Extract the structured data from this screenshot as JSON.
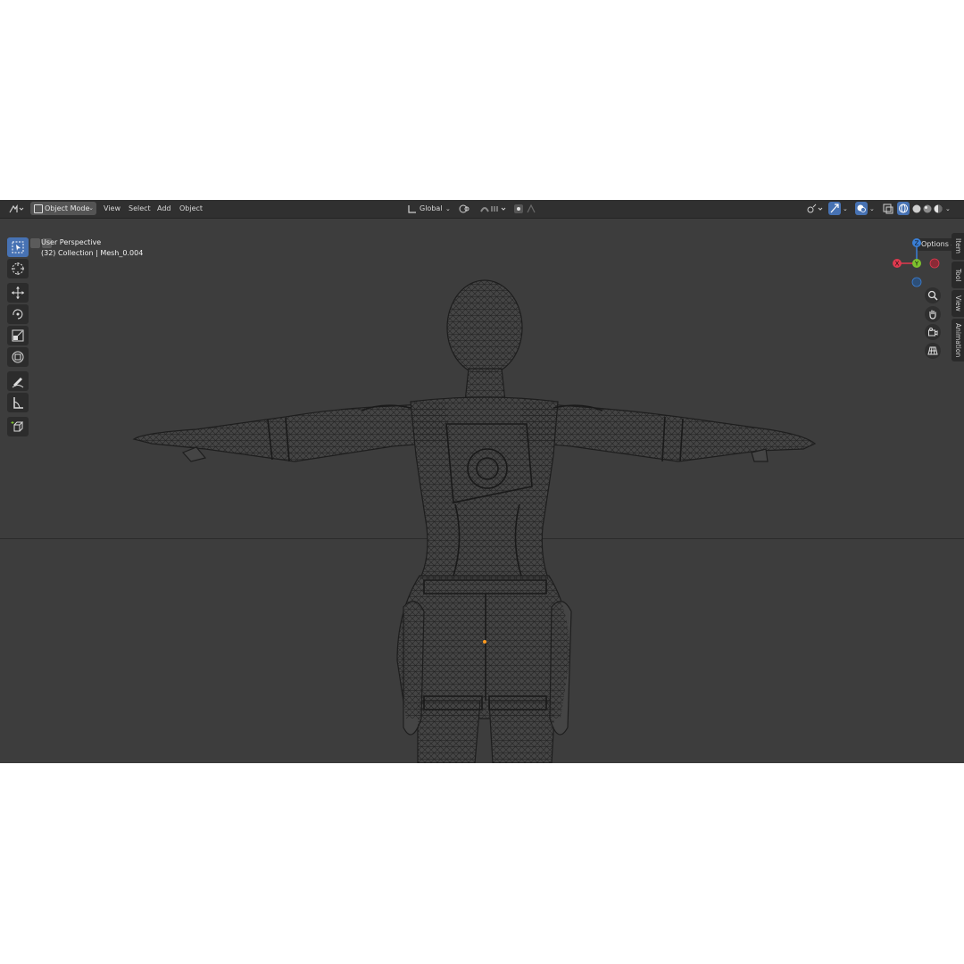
{
  "header": {
    "mode_label": "Object Mode",
    "menu": [
      "View",
      "Select",
      "Add",
      "Object"
    ],
    "transform_orientation": "Global",
    "options_label": "Options"
  },
  "viewport": {
    "view_name": "User Perspective",
    "collection_line": "(32) Collection | Mesh_0.004"
  },
  "gizmo": {
    "x": "X",
    "y": "Y",
    "z": "Z"
  },
  "sidebar_tabs": [
    "Item",
    "Tool",
    "View",
    "Animation"
  ],
  "toolbar": [
    "select-box-icon",
    "cursor-icon",
    "move-icon",
    "rotate-icon",
    "scale-icon",
    "transform-icon",
    "annotate-icon",
    "measure-icon",
    "add-cube-icon"
  ],
  "colors": {
    "viewport_bg": "#3d3d3d",
    "header_bg": "#303030",
    "accent": "#4772b3",
    "axis_x": "#e0394f",
    "axis_y": "#7ec22e",
    "axis_z": "#3a7fd6"
  }
}
